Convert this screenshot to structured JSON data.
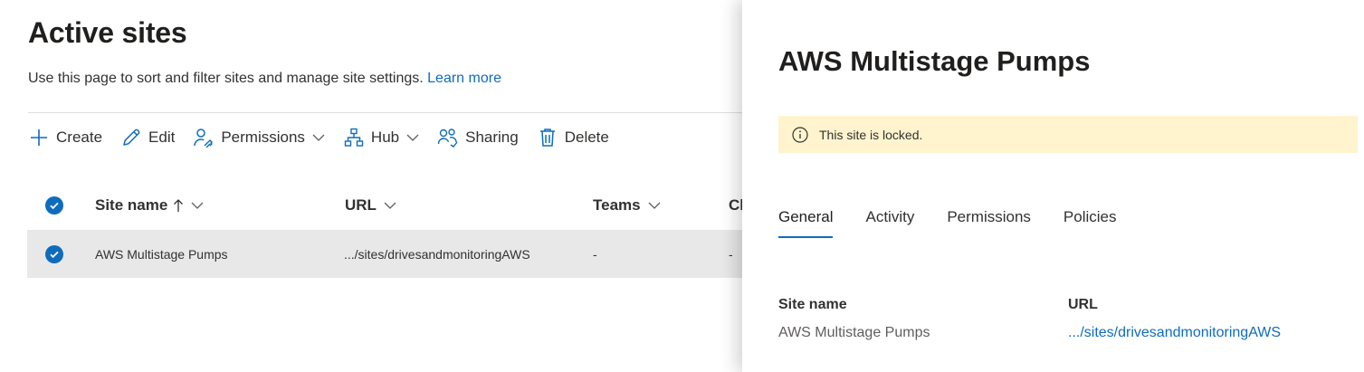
{
  "main": {
    "title": "Active sites",
    "subtitle": "Use this page to sort and filter sites and manage site settings.",
    "learn_more": "Learn more",
    "toolbar": {
      "create": "Create",
      "edit": "Edit",
      "permissions": "Permissions",
      "hub": "Hub",
      "sharing": "Sharing",
      "delete": "Delete"
    },
    "columns": {
      "site_name": "Site name",
      "url": "URL",
      "teams": "Teams",
      "channel_truncated": "Ch"
    },
    "rows": [
      {
        "site_name": "AWS Multistage Pumps",
        "url": ".../sites/drivesandmonitoringAWS",
        "teams": "-",
        "channel": "-"
      }
    ]
  },
  "panel": {
    "title": "AWS Multistage Pumps",
    "banner": "This site is locked.",
    "tabs": [
      "General",
      "Activity",
      "Permissions",
      "Policies"
    ],
    "active_tab": "General",
    "fields": {
      "site_name_label": "Site name",
      "site_name_value": "AWS Multistage Pumps",
      "url_label": "URL",
      "url_value": ".../sites/drivesandmonitoringAWS"
    }
  },
  "colors": {
    "accent": "#0f6cbd",
    "banner_bg": "#fff4ce",
    "selected_row_bg": "#e8e8e8"
  }
}
